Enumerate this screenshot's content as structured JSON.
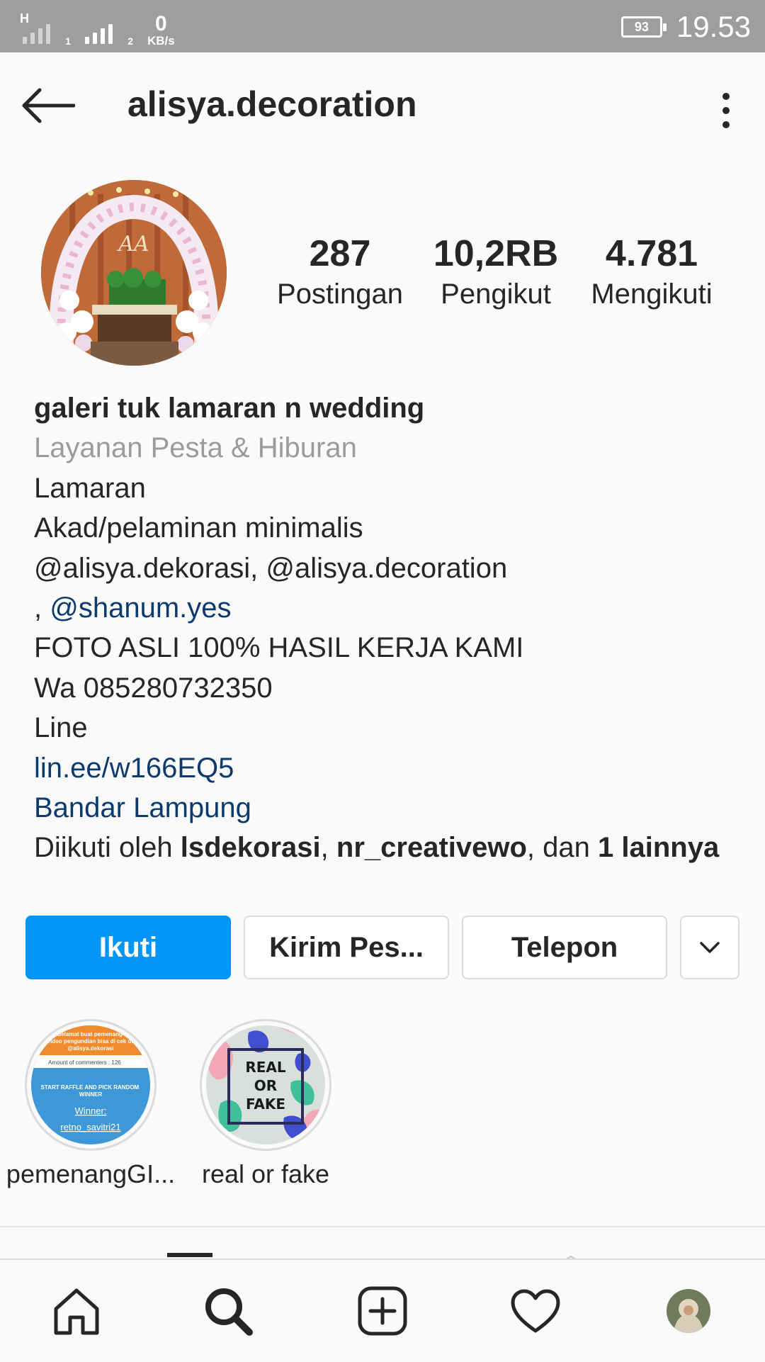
{
  "status_bar": {
    "network_type": "H",
    "sim1_label": "1",
    "sim2_label": "2",
    "speed_value": "0",
    "speed_unit": "KB/s",
    "battery_level": "93",
    "time": "19.53"
  },
  "header": {
    "username": "alisya.decoration",
    "icons": {
      "back": "arrow-left-icon",
      "more": "more-vertical-icon"
    }
  },
  "profile": {
    "stats": [
      {
        "value": "287",
        "label": "Postingan"
      },
      {
        "value": "10,2RB",
        "label": "Pengikut"
      },
      {
        "value": "4.781",
        "label": "Mengikuti"
      }
    ]
  },
  "bio": {
    "name": "galeri tuk lamaran n wedding",
    "category": "Layanan Pesta & Hiburan",
    "line1": "Lamaran",
    "line2": "Akad/pelaminan minimalis",
    "line3": "@alisya.dekorasi, @alisya.decoration",
    "line4_prefix": ", ",
    "line4_mention": "@shanum.yes",
    "line5": "FOTO ASLI 100% HASIL KERJA KAMI",
    "line6": "Wa 085280732350",
    "line7": "Line",
    "link": "lin.ee/w166EQ5",
    "location": "Bandar Lampung",
    "followed_by": {
      "prefix": "Diikuti oleh ",
      "user1": "lsdekorasi",
      "sep": ", ",
      "user2": "nr_creativewo",
      "mid": ", dan ",
      "others": "1 lainnya"
    }
  },
  "actions": {
    "follow": "Ikuti",
    "message": "Kirim Pes...",
    "call": "Telepon",
    "more_icon": "chevron-down-icon"
  },
  "highlights": [
    {
      "label": "pemenangGI...",
      "cover": {
        "banner": "Selamat buat pemenang Video pengundian bisa di cek di @alisya.dekorasi",
        "count": "Amount of commenters : 126",
        "title": "START RAFFLE AND PICK RANDOM WINNER",
        "winner_label": "Winner:",
        "winner": "retno_savitri21"
      }
    },
    {
      "label": "real or fake",
      "cover": {
        "text1": "REAL",
        "text2": "OR",
        "text3": "FAKE"
      }
    }
  ],
  "bottom_nav": {
    "items": [
      "home-icon",
      "search-icon",
      "add-post-icon",
      "activity-heart-icon",
      "profile-avatar"
    ]
  },
  "colors": {
    "accent": "#0095f6",
    "link": "#0a3a6e",
    "status_bar": "#9e9e9e",
    "text": "#262626",
    "secondary": "#9b9b9b"
  }
}
